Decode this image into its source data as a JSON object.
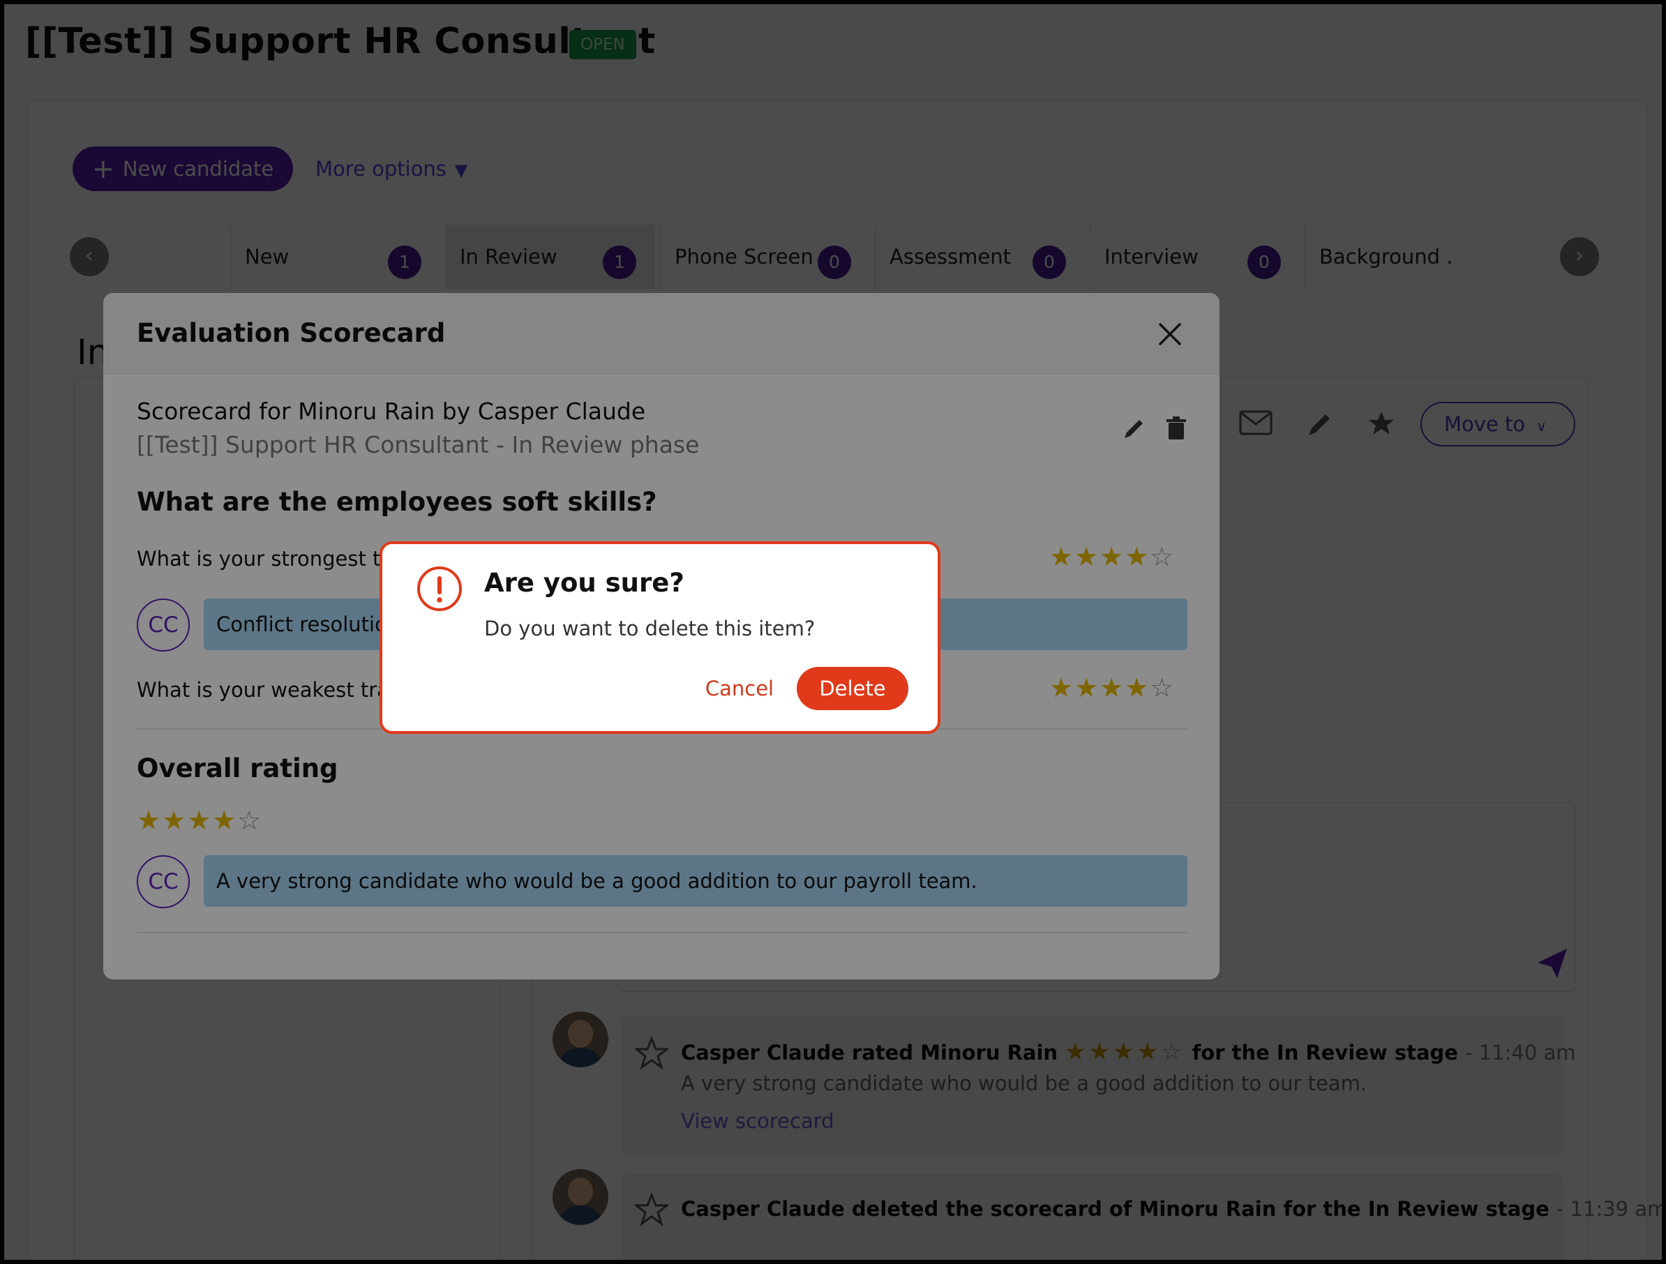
{
  "page": {
    "title": "[[Test]] Support HR Consultant",
    "status_badge": "OPEN"
  },
  "toolbar": {
    "new_candidate": "New candidate",
    "more_options": "More options"
  },
  "stages": [
    {
      "label": "New",
      "count": "1"
    },
    {
      "label": "In Review",
      "count": "1"
    },
    {
      "label": "Phone Screen",
      "count": "0"
    },
    {
      "label": "Assessment",
      "count": "0"
    },
    {
      "label": "Interview",
      "count": "0"
    },
    {
      "label": "Background ."
    }
  ],
  "background": {
    "section_letters": "In",
    "move_to": "Move to"
  },
  "activity": [
    {
      "author_action": "Casper Claude rated Minoru Rain",
      "rating": 4,
      "rating_max": 5,
      "suffix": "for the In Review stage",
      "time": "- 11:40 am",
      "text": "A very strong candidate who would be a good addition to our team.",
      "link": "View scorecard"
    },
    {
      "author_action": "Casper Claude deleted the scorecard of Minoru Rain for the In Review stage",
      "time": "- 11:39 am"
    }
  ],
  "scorecard": {
    "title": "Evaluation Scorecard",
    "for_line": "Scorecard for Minoru Rain by Casper Claude",
    "sub_line": "[[Test]] Support HR Consultant - In Review phase",
    "section_title": "What are the employees soft skills?",
    "questions": [
      {
        "text": "What is your strongest tra",
        "rating": 4,
        "rating_max": 5,
        "answer": "Conflict resolutio",
        "avatar": "CC"
      },
      {
        "text": "What is your weakest trait",
        "rating": 4,
        "rating_max": 5
      }
    ],
    "overall_title": "Overall rating",
    "overall_rating": 4,
    "overall_rating_max": 5,
    "overall_comment": "A very strong candidate who would be a good addition to our payroll team.",
    "overall_avatar": "CC"
  },
  "confirm": {
    "title": "Are you sure?",
    "message": "Do you want to delete this item?",
    "cancel": "Cancel",
    "delete": "Delete"
  },
  "colors": {
    "primary": "#5b21b6",
    "danger": "#e03a1a",
    "star": "#e6b800",
    "answer_bg": "#a8d8f8",
    "open_badge": "#1a9b4b"
  }
}
